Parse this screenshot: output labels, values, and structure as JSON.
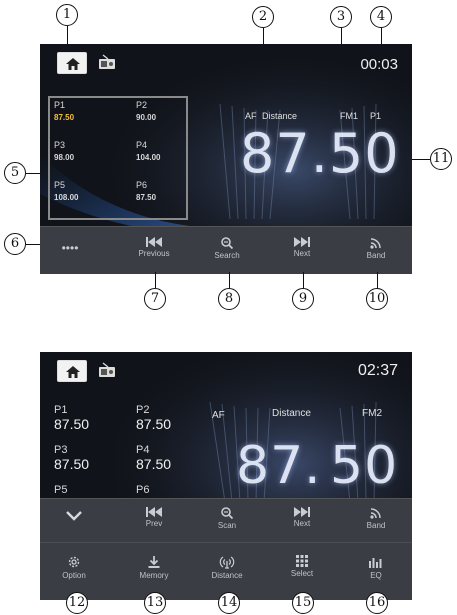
{
  "callouts": [
    "1",
    "2",
    "3",
    "4",
    "5",
    "6",
    "7",
    "8",
    "9",
    "10",
    "11",
    "12",
    "13",
    "14",
    "15",
    "16"
  ],
  "screen1": {
    "clock": "00:03",
    "af": "AF",
    "distance": "Distance",
    "band": "FM1",
    "preset_sel": "P1",
    "frequency": "87.50",
    "dots": "••••",
    "presets": [
      {
        "label": "P1",
        "value": "87.50"
      },
      {
        "label": "P2",
        "value": "90.00"
      },
      {
        "label": "P3",
        "value": "98.00"
      },
      {
        "label": "P4",
        "value": "104.00"
      },
      {
        "label": "P5",
        "value": "108.00"
      },
      {
        "label": "P6",
        "value": "87.50"
      }
    ],
    "buttons": {
      "previous": "Previous",
      "search": "Search",
      "next": "Next",
      "band": "Band"
    }
  },
  "screen2": {
    "clock": "02:37",
    "af": "AF",
    "distance": "Distance",
    "band": "FM2",
    "frequency_int": "87",
    "frequency_dot": ".",
    "frequency_dec": "50",
    "presets": [
      {
        "label": "P1",
        "value": "87.50"
      },
      {
        "label": "P2",
        "value": "87.50"
      },
      {
        "label": "P3",
        "value": "87.50"
      },
      {
        "label": "P4",
        "value": "87.50"
      },
      {
        "label": "P5",
        "value": ""
      },
      {
        "label": "P6",
        "value": ""
      }
    ],
    "row1": {
      "prev": "Prev",
      "scan": "Scan",
      "next": "Next",
      "band": "Band"
    },
    "row2": {
      "option": "Option",
      "memory": "Memory",
      "distance": "Distance",
      "select": "Select",
      "eq": "EQ"
    }
  },
  "colors": {
    "screen_bg": "#101319",
    "button_bar": "#3a3d44",
    "preset_highlight": "#f0c040"
  }
}
